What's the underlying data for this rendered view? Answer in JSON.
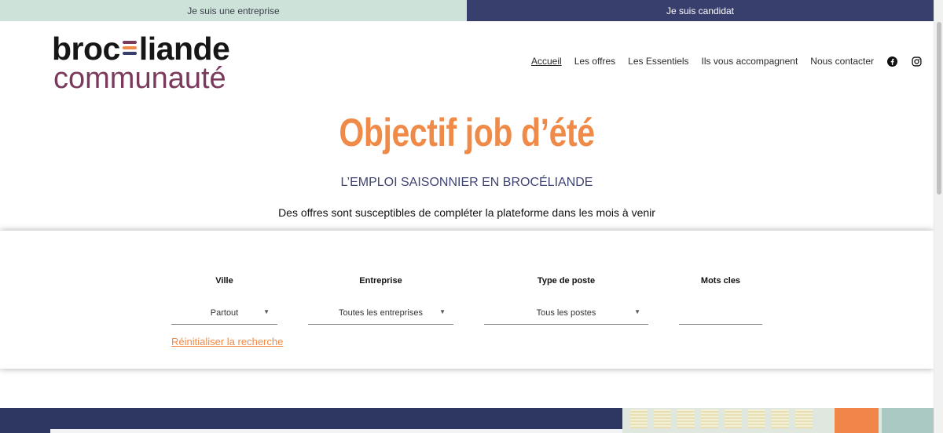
{
  "topbar": {
    "company_label": "Je suis une entreprise",
    "candidate_label": "Je suis candidat"
  },
  "logo": {
    "line1": "brocéliande",
    "line2": "communauté"
  },
  "nav": {
    "items": [
      {
        "label": "Accueil",
        "active": true
      },
      {
        "label": "Les offres"
      },
      {
        "label": "Les Essentiels"
      },
      {
        "label": "Ils vous accompagnent"
      },
      {
        "label": "Nous contacter"
      }
    ],
    "social": [
      "facebook-icon",
      "instagram-icon"
    ]
  },
  "hero": {
    "title": "Objectif job d’été",
    "subtitle": "L’EMPLOI SAISONNIER EN BROCÉLIANDE",
    "note": "Des offres sont susceptibles de compléter la plateforme dans les mois à venir"
  },
  "search": {
    "ville": {
      "label": "Ville",
      "value": "Partout"
    },
    "entreprise": {
      "label": "Entreprise",
      "value": "Toutes les entreprises"
    },
    "type_poste": {
      "label": "Type de poste",
      "value": "Tous les postes"
    },
    "mots_cles": {
      "label": "Mots cles",
      "value": ""
    },
    "reset_label": "Réinitialiser la recherche"
  },
  "colors": {
    "accent_orange": "#ef8a48",
    "navy": "#383f6d",
    "mint": "#cde3da",
    "plum": "#7a3a5c"
  }
}
